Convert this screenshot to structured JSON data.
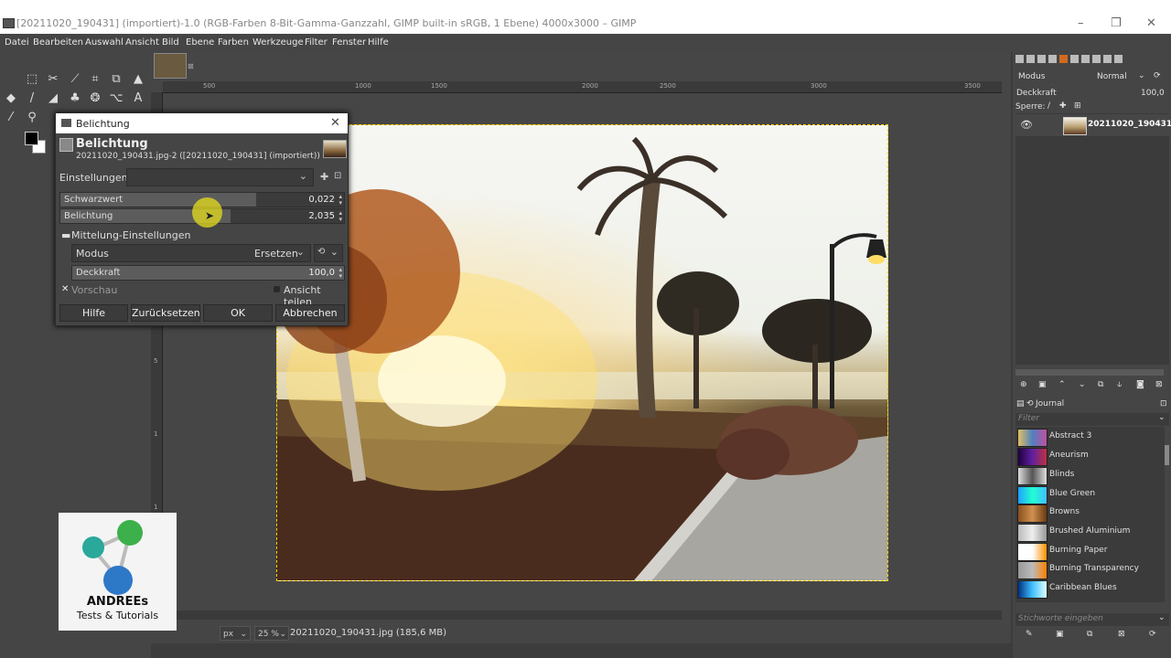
{
  "window": {
    "title": "[20211020_190431] (importiert)-1.0 (RGB-Farben 8-Bit-Gamma-Ganzzahl, GIMP built-in sRGB, 1 Ebene) 4000x3000 – GIMP",
    "minimize": "–",
    "maximize": "❐",
    "close": "✕"
  },
  "menu": [
    "Datei",
    "Bearbeiten",
    "Auswahl",
    "Ansicht",
    "Bild",
    "Ebene",
    "Farben",
    "Werkzeuge",
    "Filter",
    "Fenster",
    "Hilfe"
  ],
  "toolbox": {
    "tools": [
      {
        "name": "rect-select-icon",
        "glyph": "⬚"
      },
      {
        "name": "free-select-icon",
        "glyph": "✂"
      },
      {
        "name": "fuzzy-select-icon",
        "glyph": "⟋"
      },
      {
        "name": "crop-icon",
        "glyph": "⌗"
      },
      {
        "name": "transform-icon",
        "glyph": "⧉"
      },
      {
        "name": "warp-icon",
        "glyph": "▲"
      },
      {
        "name": "bucket-fill-icon",
        "glyph": "◆"
      },
      {
        "name": "paintbrush-icon",
        "glyph": "/"
      },
      {
        "name": "eraser-icon",
        "glyph": "◢"
      },
      {
        "name": "clone-icon",
        "glyph": "♣"
      },
      {
        "name": "smudge-icon",
        "glyph": "❂"
      },
      {
        "name": "path-icon",
        "glyph": "⌥"
      },
      {
        "name": "text-icon",
        "glyph": "A"
      },
      {
        "name": "color-picker-icon",
        "glyph": "⁄"
      },
      {
        "name": "zoom-icon",
        "glyph": "⚲"
      }
    ]
  },
  "rulers": {
    "h_labels": [
      "500",
      "1000",
      "1500",
      "2000",
      "2500",
      "3000",
      "3500"
    ],
    "v_labels": [
      "5",
      "1",
      "1",
      "1",
      "2"
    ]
  },
  "status": {
    "unit": "px",
    "zoom": "25 %",
    "filename": "20211020_190431.jpg (185,6 MB)"
  },
  "layers": {
    "mode_label": "Modus",
    "mode_value": "Normal",
    "opacity_label": "Deckkraft",
    "opacity_value": "100,0",
    "lock_label": "Sperre:",
    "layer_name": "20211020_190431."
  },
  "journal": {
    "tab_label": "Journal",
    "filter_placeholder": "Filter",
    "tags_placeholder": "Stichworte eingeben",
    "gradients": [
      {
        "name": "Abstract 3",
        "colors": [
          "#e0c060",
          "#5080c0",
          "#c050a0"
        ]
      },
      {
        "name": "Aneurism",
        "colors": [
          "#200040",
          "#6020a0",
          "#c03040"
        ]
      },
      {
        "name": "Blinds",
        "colors": [
          "#dddddd",
          "#555555",
          "#dddddd"
        ]
      },
      {
        "name": "Blue Green",
        "colors": [
          "#20a0ff",
          "#20ffd0",
          "#40c0ff"
        ]
      },
      {
        "name": "Browns",
        "colors": [
          "#8a5020",
          "#d09050",
          "#6a3a10"
        ]
      },
      {
        "name": "Brushed Aluminium",
        "colors": [
          "#bbbbbb",
          "#eeeeee",
          "#999999"
        ]
      },
      {
        "name": "Burning Paper",
        "colors": [
          "#ffffff",
          "#ffffff",
          "#ff9000"
        ]
      },
      {
        "name": "Burning Transparency",
        "colors": [
          "#999999",
          "#bbbbbb",
          "#ff8000"
        ]
      },
      {
        "name": "Caribbean Blues",
        "colors": [
          "#003080",
          "#40c0ff",
          "#e0ffff"
        ]
      }
    ]
  },
  "dialog": {
    "title": "Belichtung",
    "heading": "Belichtung",
    "subtitle": "20211020_190431.jpg-2 ([20211020_190431] (importiert))",
    "presets_label": "Einstellungen:",
    "black_label": "Schwarzwert",
    "black_value": "0,022",
    "black_fraction": 0.69,
    "exposure_label": "Belichtung",
    "exposure_value": "2,035",
    "exposure_fraction": 0.6,
    "blending_label": "Mittelung-Einstellungen",
    "mode_label": "Modus",
    "mode_value": "Ersetzen",
    "opacity_label": "Deckkraft",
    "opacity_value": "100,0",
    "preview_label": "Vorschau",
    "split_label": "Ansicht teilen",
    "buttons": {
      "help": "Hilfe",
      "reset": "Zurücksetzen",
      "ok": "OK",
      "cancel": "Abbrechen"
    }
  },
  "watermark": {
    "line1": "ANDREEs",
    "line2": "Tests & Tutorials"
  }
}
